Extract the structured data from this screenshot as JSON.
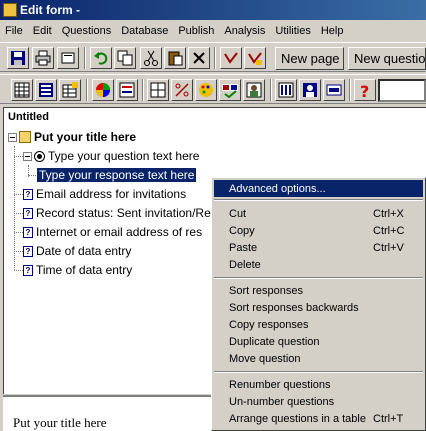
{
  "window": {
    "title": "Edit form -"
  },
  "menubar": [
    "File",
    "Edit",
    "Questions",
    "Database",
    "Publish",
    "Analysis",
    "Utilities",
    "Help"
  ],
  "toolbar": {
    "new_page_label": "New page",
    "new_question_label": "New questio"
  },
  "tree": {
    "root_label": "Untitled",
    "title_label": "Put your title here",
    "question_label": "Type your question text here",
    "response_label": "Type your response text here",
    "items": [
      "Email address for invitations",
      "Record status: Sent invitation/Re",
      "Internet or email address of res",
      "Date of data entry",
      "Time of data entry"
    ]
  },
  "preview": {
    "title": "Put your title here"
  },
  "context_menu": {
    "items": [
      {
        "label": "Advanced options...",
        "shortcut": ""
      },
      {
        "label": "Cut",
        "shortcut": "Ctrl+X"
      },
      {
        "label": "Copy",
        "shortcut": "Ctrl+C"
      },
      {
        "label": "Paste",
        "shortcut": "Ctrl+V"
      },
      {
        "label": "Delete",
        "shortcut": ""
      },
      {
        "label": "Sort responses",
        "shortcut": ""
      },
      {
        "label": "Sort responses backwards",
        "shortcut": ""
      },
      {
        "label": "Copy responses",
        "shortcut": ""
      },
      {
        "label": "Duplicate question",
        "shortcut": ""
      },
      {
        "label": "Move question",
        "shortcut": ""
      },
      {
        "label": "Renumber questions",
        "shortcut": ""
      },
      {
        "label": "Un-number questions",
        "shortcut": ""
      },
      {
        "label": "Arrange questions in a table",
        "shortcut": "Ctrl+T"
      }
    ]
  },
  "colors": {
    "selection": "#0a246a",
    "face": "#d4d0c8"
  }
}
